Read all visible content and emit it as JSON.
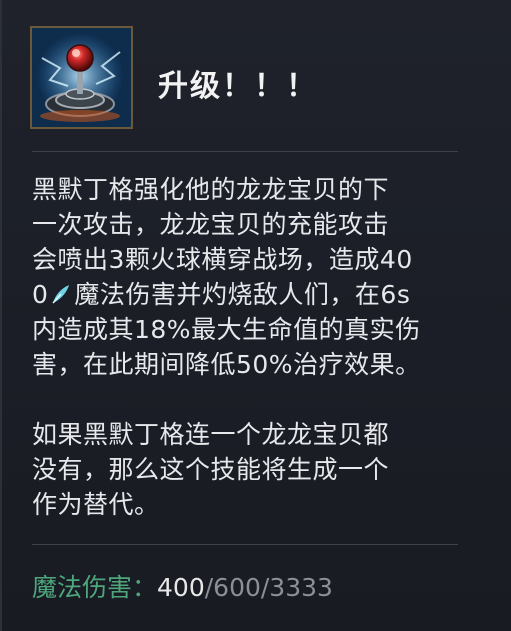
{
  "ability": {
    "icon": "dragon-egg-orb-icon",
    "title": "升级！！！"
  },
  "description": {
    "paragraph1_lines": [
      "黑默丁格强化他的龙龙宝贝的下",
      "一次攻击，龙龙宝贝的充能攻击",
      "会喷出3颗火球横穿战场，造成40",
      "魔法伤害并灼烧敌人们，在6s",
      "内造成其18%最大生命值的真实伤",
      "害，在此期间降低50%治疗效果。"
    ],
    "line4_prefix": "0",
    "magic_damage_icon": "magic-damage-icon",
    "paragraph2_lines": [
      "如果黑默丁格连一个龙龙宝贝都",
      "没有，那么这个技能将生成一个",
      "作为替代。"
    ]
  },
  "stats": {
    "label": "魔法伤害：",
    "current_value": "400",
    "other_values": "/600/3333"
  },
  "colors": {
    "background": "#1d2028",
    "stat_label": "#4ea67d",
    "magic_icon": "#6fd3e6",
    "divider": "#3d414b"
  }
}
